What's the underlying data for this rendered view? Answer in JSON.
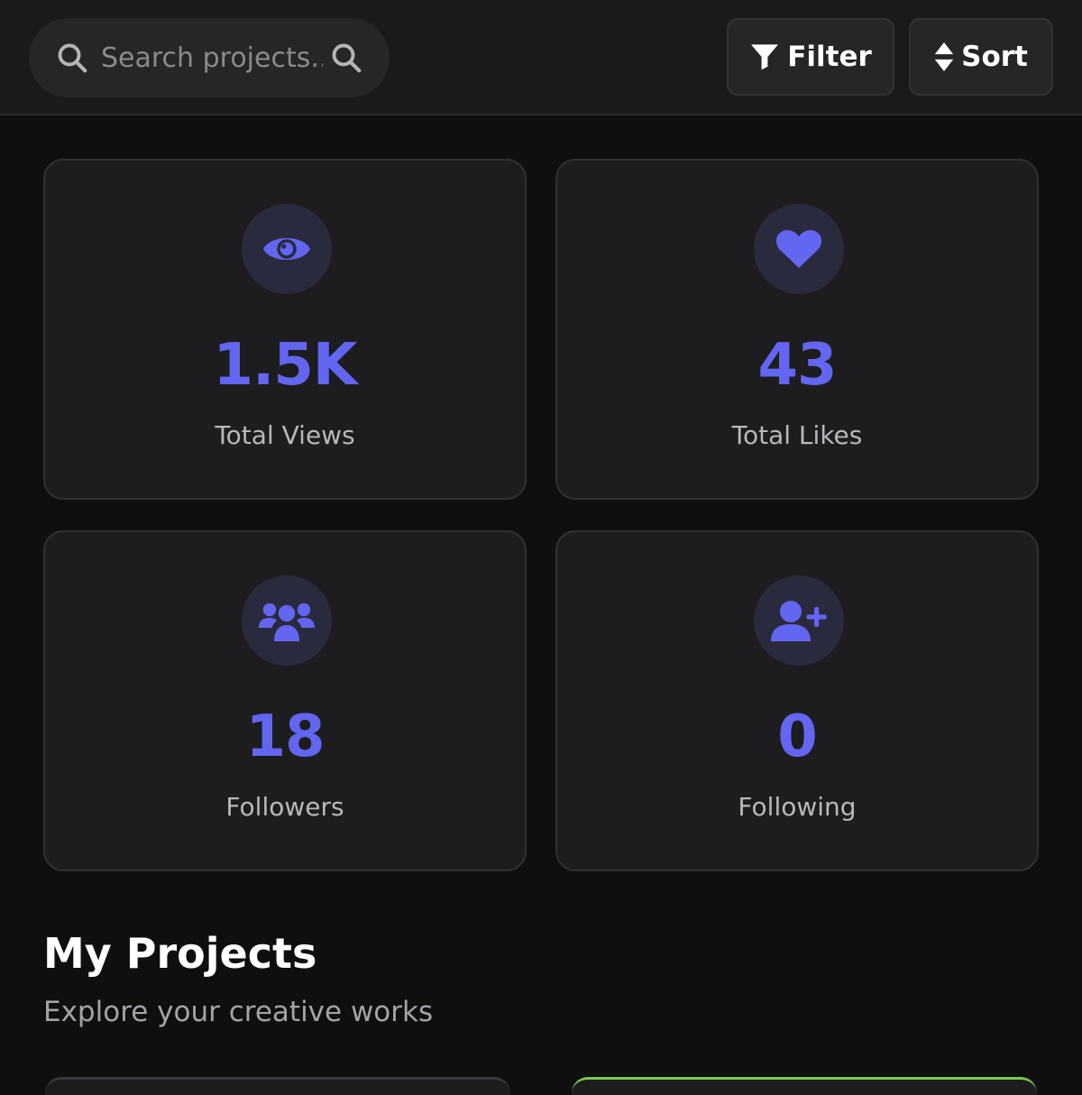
{
  "header": {
    "search": {
      "placeholder": "Search projects...",
      "value": ""
    },
    "filter_label": "Filter",
    "sort_label": "Sort"
  },
  "stats": [
    {
      "icon": "eye-icon",
      "value": "1.5K",
      "label": "Total Views"
    },
    {
      "icon": "heart-icon",
      "value": "43",
      "label": "Total Likes"
    },
    {
      "icon": "users-icon",
      "value": "18",
      "label": "Followers"
    },
    {
      "icon": "user-plus-icon",
      "value": "0",
      "label": "Following"
    }
  ],
  "projects": {
    "title": "My Projects",
    "subtitle": "Explore your creative works"
  },
  "colors": {
    "accent": "#6366f1",
    "background": "#0f0f10",
    "card": "#1d1d1f",
    "peek_green": "#7bc94a"
  }
}
